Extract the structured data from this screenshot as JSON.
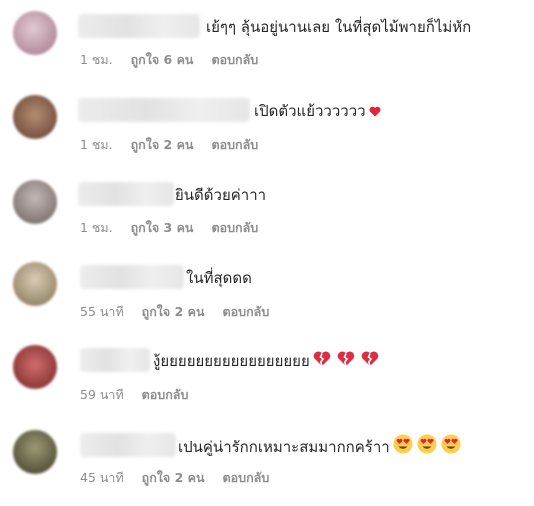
{
  "comments": [
    {
      "text": "เย้ๆๆ ลุ้นอยู่นานเลย ในที่สุดไม้พายก็ไม่หัก",
      "time": "1 ชม.",
      "likes": "ถูกใจ 6 คน",
      "reply": "ตอบกลับ",
      "avatar_color": "#c9a7b4"
    },
    {
      "text": "เปิดตัวแย้วววววว",
      "time": "1 ชม.",
      "likes": "ถูกใจ 2 คน",
      "reply": "ตอบกลับ",
      "avatar_color": "#8c6a55",
      "emoji": [
        "red-heart"
      ]
    },
    {
      "text": "ยินดีด้วยค่าาา",
      "time": "1 ชม.",
      "likes": "ถูกใจ 3 คน",
      "reply": "ตอบกลับ",
      "avatar_color": "#9a8f8b"
    },
    {
      "text": "ในที่สุดดด",
      "time": "55 นาที",
      "likes": "ถูกใจ 2 คน",
      "reply": "ตอบกลับ",
      "avatar_color": "#b5a58a"
    },
    {
      "text": "งู้ยยยยยยยยยยยยยยยยย",
      "time": "59 นาที",
      "likes": "",
      "reply": "ตอบกลับ",
      "avatar_color": "#a44545",
      "emoji": [
        "broken-heart",
        "broken-heart",
        "broken-heart"
      ]
    },
    {
      "text": "เปนคู่น่ารักกเหมาะสมมากกคร้าา",
      "time": "45 นาที",
      "likes": "ถูกใจ 2 คน",
      "reply": "ตอบกลับ",
      "avatar_color": "#6c6a4c",
      "emoji": [
        "heart-eyes",
        "heart-eyes",
        "heart-eyes"
      ]
    }
  ]
}
